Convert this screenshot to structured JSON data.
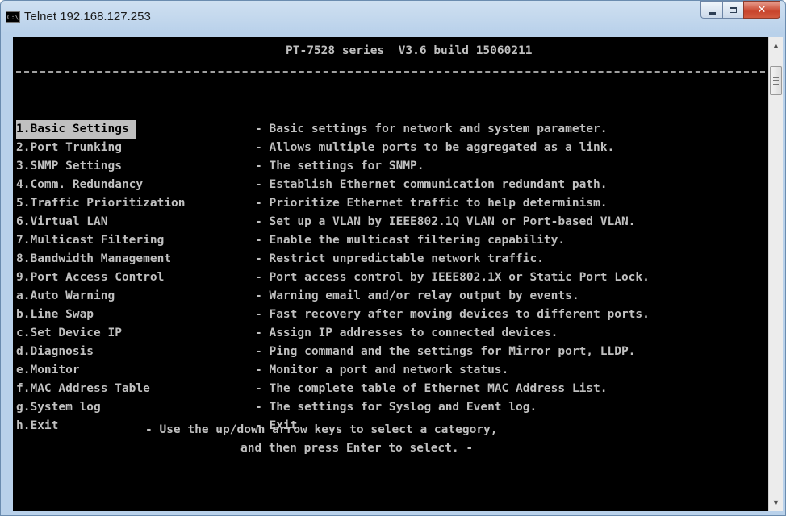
{
  "window": {
    "title": "Telnet 192.168.127.253",
    "icon": "C:\\",
    "controls": {
      "minimize": "minimize-icon",
      "maximize": "maximize-icon",
      "close": "✕"
    }
  },
  "terminal": {
    "header": "PT-7528 series  V3.6 build 15060211",
    "menu": [
      {
        "key": "1.Basic Settings",
        "desc": "- Basic settings for network and system parameter.",
        "selected": true
      },
      {
        "key": "2.Port Trunking",
        "desc": "- Allows multiple ports to be aggregated as a link."
      },
      {
        "key": "3.SNMP Settings",
        "desc": "- The settings for SNMP."
      },
      {
        "key": "4.Comm. Redundancy",
        "desc": "- Establish Ethernet communication redundant path."
      },
      {
        "key": "5.Traffic Prioritization",
        "desc": "- Prioritize Ethernet traffic to help determinism."
      },
      {
        "key": "6.Virtual LAN",
        "desc": "- Set up a VLAN by IEEE802.1Q VLAN or Port-based VLAN."
      },
      {
        "key": "7.Multicast Filtering",
        "desc": "- Enable the multicast filtering capability."
      },
      {
        "key": "8.Bandwidth Management",
        "desc": "- Restrict unpredictable network traffic."
      },
      {
        "key": "9.Port Access Control",
        "desc": "- Port access control by IEEE802.1X or Static Port Lock."
      },
      {
        "key": "a.Auto Warning",
        "desc": "- Warning email and/or relay output by events."
      },
      {
        "key": "b.Line Swap",
        "desc": "- Fast recovery after moving devices to different ports."
      },
      {
        "key": "c.Set Device IP",
        "desc": "- Assign IP addresses to connected devices."
      },
      {
        "key": "d.Diagnosis",
        "desc": "- Ping command and the settings for Mirror port, LLDP."
      },
      {
        "key": "e.Monitor",
        "desc": "- Monitor a port and network status."
      },
      {
        "key": "f.MAC Address Table",
        "desc": "- The complete table of Ethernet MAC Address List."
      },
      {
        "key": "g.System log",
        "desc": "- The settings for Syslog and Event log."
      },
      {
        "key": "h.Exit",
        "desc": "- Exit"
      }
    ],
    "hint_line1": "- Use the up/down arrow keys to select a category,",
    "hint_line2": "and then press Enter to select. -"
  },
  "scrollbar": {
    "up_icon": "▲",
    "down_icon": "▼",
    "position": 0
  }
}
